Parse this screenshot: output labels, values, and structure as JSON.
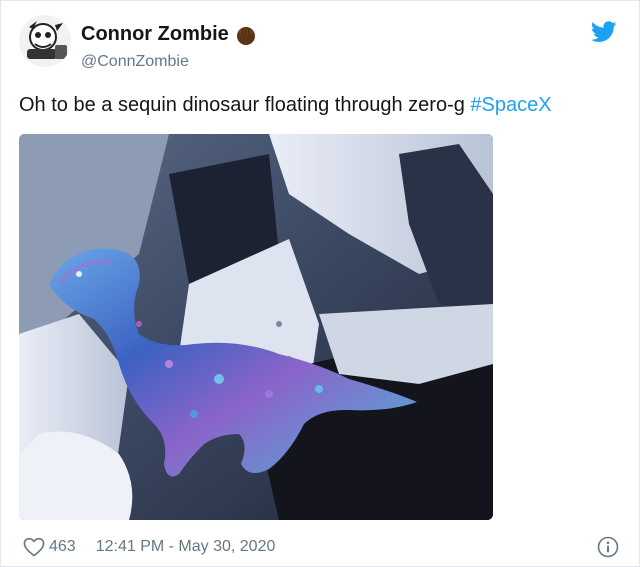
{
  "tweet": {
    "display_name": "Connor Zombie",
    "handle": "@ConnZombie",
    "text_prefix": "Oh to be a sequin dinosaur floating through zero-g ",
    "hashtag": "#SpaceX",
    "like_count": "463",
    "timestamp": "12:41 PM - May 30, 2020"
  },
  "icons": {
    "name_emoji": "fist-emoji-icon",
    "brand": "twitter-bird-icon",
    "like": "heart-icon",
    "info": "info-icon"
  },
  "colors": {
    "brand_blue": "#1da1f2",
    "text_primary": "#14171a",
    "text_secondary": "#657786"
  }
}
